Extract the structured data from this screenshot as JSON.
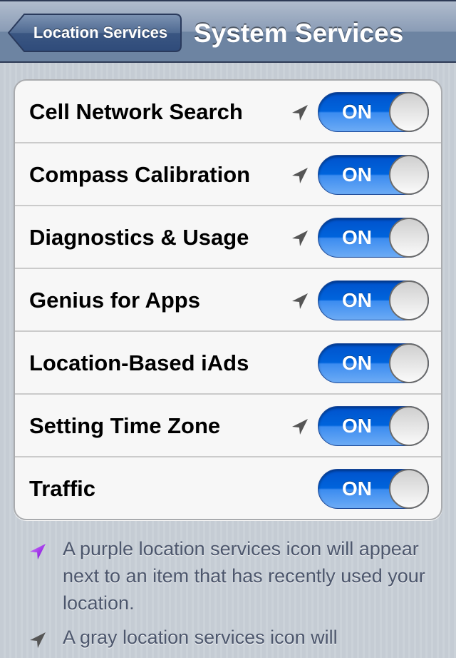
{
  "navbar": {
    "back_label": "Location Services",
    "title": "System Services"
  },
  "rows": [
    {
      "label": "Cell Network Search",
      "location_icon": "gray-location-arrow",
      "toggle": "ON"
    },
    {
      "label": "Compass Calibration",
      "location_icon": "gray-location-arrow",
      "toggle": "ON"
    },
    {
      "label": "Diagnostics & Usage",
      "location_icon": "gray-location-arrow",
      "toggle": "ON"
    },
    {
      "label": "Genius for Apps",
      "location_icon": "gray-location-arrow",
      "toggle": "ON"
    },
    {
      "label": "Location-Based iAds",
      "location_icon": null,
      "toggle": "ON"
    },
    {
      "label": "Setting Time Zone",
      "location_icon": "gray-location-arrow",
      "toggle": "ON"
    },
    {
      "label": "Traffic",
      "location_icon": null,
      "toggle": "ON"
    }
  ],
  "footer": {
    "notes": [
      {
        "icon": "purple-location-arrow",
        "text": "A purple location services icon will appear next to an item that has recently used your location."
      },
      {
        "icon": "gray-location-arrow",
        "text": "A gray location services icon will"
      }
    ]
  },
  "colors": {
    "toggle_on": "#0064dc",
    "purple_icon": "#9b1fe8",
    "gray_icon": "#555555",
    "nav_bar": "#6d84a2"
  }
}
